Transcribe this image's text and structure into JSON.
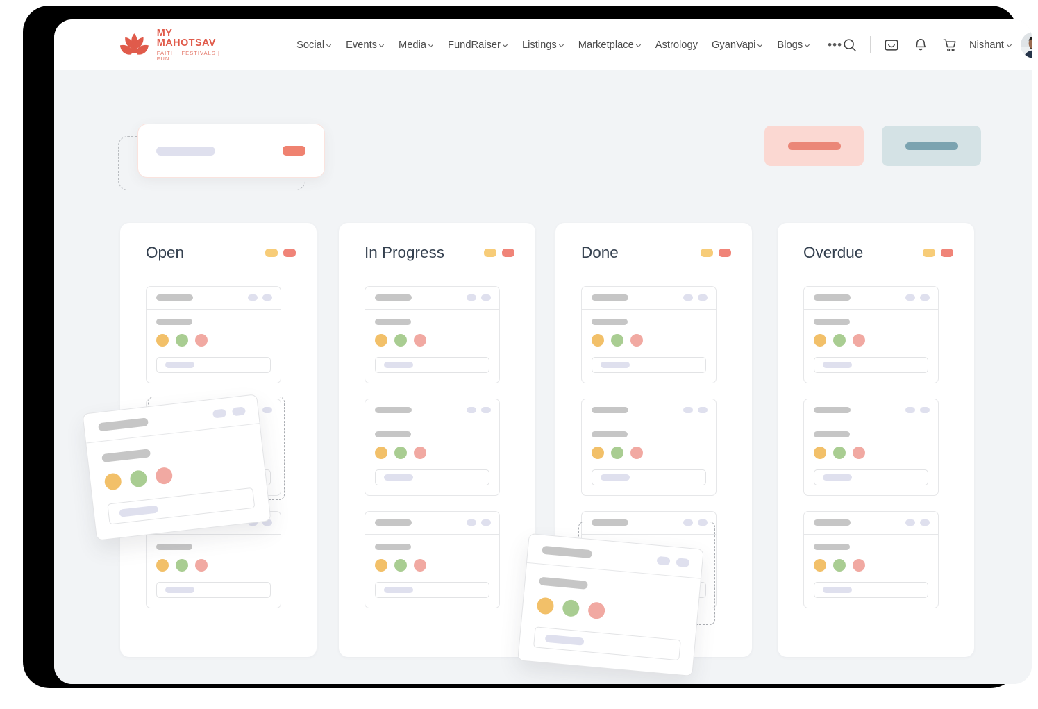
{
  "brand": {
    "name": "MY MAHOTSAV",
    "tagline": "FAITH | FESTIVALS | FUN",
    "logo_icon": "lotus-flower-icon",
    "brand_color": "#e05b4b"
  },
  "nav": {
    "menu": [
      {
        "label": "Social",
        "has_dropdown": true
      },
      {
        "label": "Events",
        "has_dropdown": true
      },
      {
        "label": "Media",
        "has_dropdown": true
      },
      {
        "label": "FundRaiser",
        "has_dropdown": true
      },
      {
        "label": "Listings",
        "has_dropdown": true
      },
      {
        "label": "Marketplace",
        "has_dropdown": true
      },
      {
        "label": "Astrology",
        "has_dropdown": false
      },
      {
        "label": "GyanVapi",
        "has_dropdown": true
      },
      {
        "label": "Blogs",
        "has_dropdown": true
      }
    ],
    "more_label": "•••",
    "tools": [
      {
        "icon": "search-icon"
      },
      {
        "icon": "inbox-icon"
      },
      {
        "icon": "bell-icon"
      },
      {
        "icon": "cart-icon"
      }
    ],
    "user": {
      "name": "Nishant",
      "has_dropdown": true,
      "avatar_icon": "user-avatar-photo"
    }
  },
  "toolbar": {
    "drag_card": {
      "skeleton_bar": "",
      "skeleton_pill": "",
      "pill_color": "#ef8270"
    },
    "drop_target_label": "",
    "actions": [
      {
        "name": "primary-action",
        "bg": "#fbd8d2",
        "bar": "#eb8778"
      },
      {
        "name": "secondary-action",
        "bg": "#d4e2e5",
        "bar": "#7ba3b0"
      }
    ]
  },
  "board": {
    "columns": [
      {
        "title": "Open",
        "badges": [
          "#f7cc78",
          "#f08478"
        ],
        "card_count": 3
      },
      {
        "title": "In Progress",
        "badges": [
          "#f7cc78",
          "#f08478"
        ],
        "card_count": 3
      },
      {
        "title": "Done",
        "badges": [
          "#f7cc78",
          "#f08478"
        ],
        "card_count": 3
      },
      {
        "title": "Overdue",
        "badges": [
          "#f7cc78",
          "#f08478"
        ],
        "card_count": 3
      }
    ],
    "card_template": {
      "header_bar": "",
      "header_pills": 2,
      "body_line": "",
      "dots": [
        "#f2c069",
        "#a9cd92",
        "#f1a9a2"
      ],
      "input_bar": ""
    },
    "dragging_cards": [
      {
        "name": "dragged-card-open",
        "rotation_deg": -6.5
      },
      {
        "name": "dragged-card-done",
        "rotation_deg": 5.2
      }
    ]
  },
  "colors": {
    "page_bg": "#f2f4f6",
    "card_bg": "#ffffff",
    "title_text": "#34404f",
    "skeleton_gray": "#c6c6c6",
    "skeleton_lavender": "#dfe0ee"
  }
}
